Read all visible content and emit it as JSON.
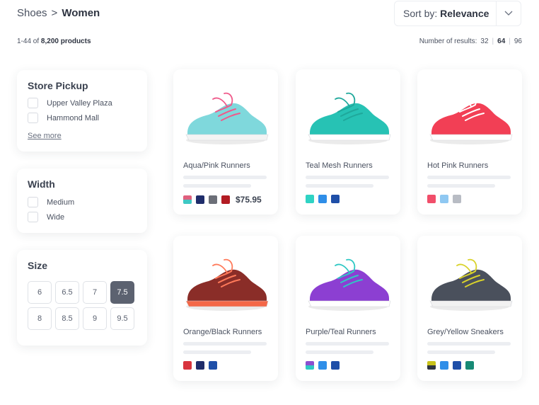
{
  "breadcrumb": {
    "parent": "Shoes",
    "separator": ">",
    "current": "Women"
  },
  "sort": {
    "label": "Sort by:",
    "value": "Relevance"
  },
  "summary": {
    "range": "1-44 of",
    "total": "8,200 products"
  },
  "results": {
    "label": "Number of results:",
    "options": [
      "32",
      "64",
      "96"
    ],
    "selected": "64"
  },
  "filters": {
    "store_pickup": {
      "title": "Store Pickup",
      "options": [
        "Upper Valley Plaza",
        "Hammond Mall"
      ],
      "see_more": "See more"
    },
    "width": {
      "title": "Width",
      "options": [
        "Medium",
        "Wide"
      ]
    },
    "size": {
      "title": "Size",
      "options": [
        "6",
        "6.5",
        "7",
        "7.5",
        "8",
        "8.5",
        "9",
        "9.5"
      ],
      "selected": "7.5"
    }
  },
  "products": [
    {
      "name": "Aqua/Pink Runners",
      "price": "$75.95",
      "swatches": [
        "#e0607e|#3fc8c4",
        "#1f2d6b",
        "#6c6f78",
        "#b31c24"
      ],
      "colors": {
        "body": "#7fd8dc",
        "accent": "#ef5a8a",
        "sole": "#f4f4f4"
      }
    },
    {
      "name": "Teal Mesh Runners",
      "price": "",
      "swatches": [
        "#2fd3c4",
        "#2f8ee8",
        "#1f4fa8"
      ],
      "colors": {
        "body": "#27c2b4",
        "accent": "#1fa89b",
        "sole": "#ffffff"
      }
    },
    {
      "name": "Hot Pink Runners",
      "price": "",
      "swatches": [
        "#f14e6a",
        "#8fc8f2",
        "#b8bcc4"
      ],
      "colors": {
        "body": "#f23f55",
        "accent": "#ffffff",
        "sole": "#ffffff"
      }
    },
    {
      "name": "Orange/Black Runners",
      "price": "",
      "swatches": [
        "#d8343e",
        "#1f2d6b",
        "#1f4fa8"
      ],
      "colors": {
        "body": "#8a2d28",
        "accent": "#ff7a5a",
        "sole": "#f46848"
      }
    },
    {
      "name": "Purple/Teal Runners",
      "price": "",
      "swatches": [
        "#8b4fd0|#2fc8c4",
        "#2f8ee8",
        "#1f4fa8"
      ],
      "colors": {
        "body": "#8c3fd2",
        "accent": "#2fc8c4",
        "sole": "#ffffff"
      }
    },
    {
      "name": "Grey/Yellow Sneakers",
      "price": "",
      "swatches": [
        "#c9c21a|#2e3441",
        "#2f8ee8",
        "#1f4fa8",
        "#178a75"
      ],
      "colors": {
        "body": "#4a505c",
        "accent": "#d9d22a",
        "sole": "#f2f2f2"
      }
    }
  ]
}
